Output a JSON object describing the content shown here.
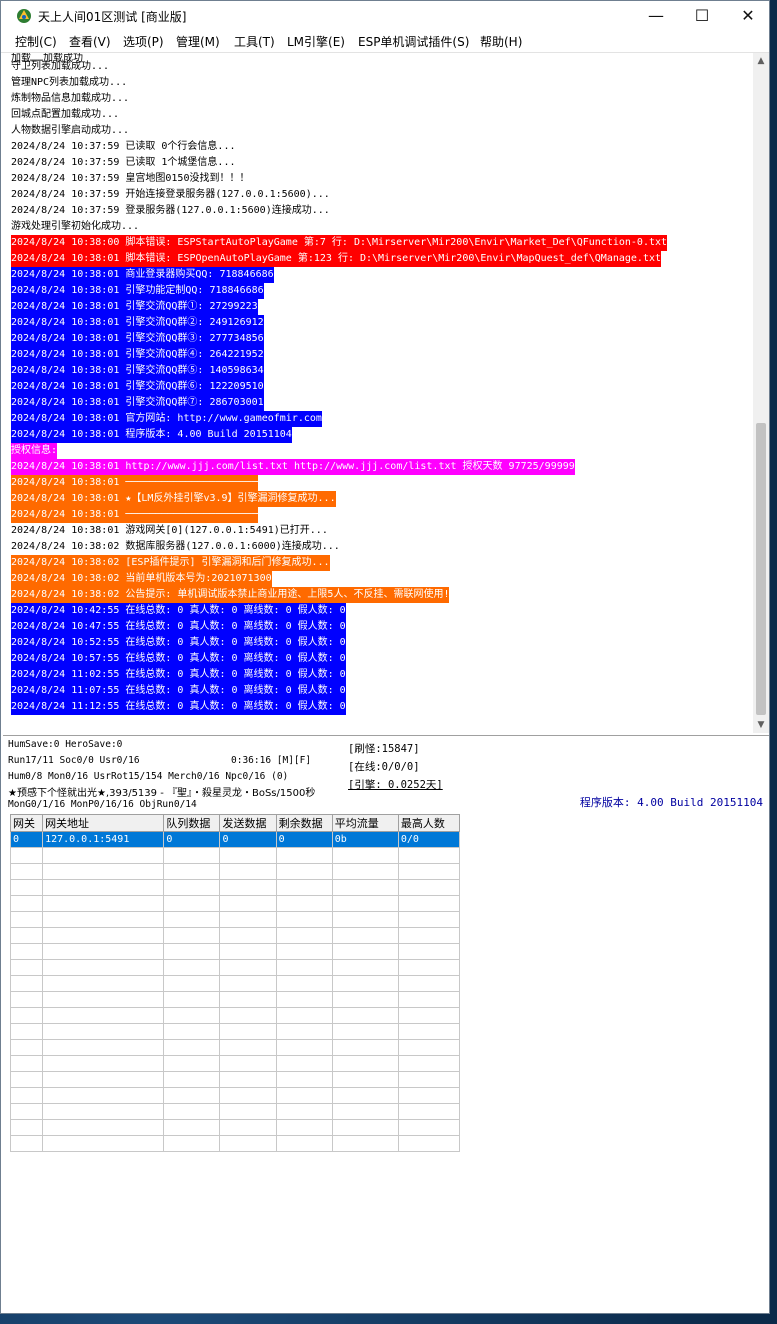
{
  "window": {
    "title": "天上人间01区测试 [商业版]",
    "controls": {
      "minimize": "—",
      "maximize": "☐",
      "close": "✕"
    }
  },
  "menu": [
    "控制(C)",
    "查看(V)",
    "选项(P)",
    "管理(M)",
    "工具(T)",
    "LM引擎(E)",
    "ESP单机调试插件(S)",
    "帮助(H)"
  ],
  "log": {
    "partial_top": "加载……加载成功",
    "lines": [
      {
        "text": "守卫列表加载成功...",
        "color": "none"
      },
      {
        "text": "管理NPC列表加载成功...",
        "color": "none"
      },
      {
        "text": "炼制物品信息加载成功...",
        "color": "none"
      },
      {
        "text": "回城点配置加载成功...",
        "color": "none"
      },
      {
        "text": "人物数据引擎启动成功...",
        "color": "none"
      },
      {
        "text": "2024/8/24 10:37:59 已读取 0个行会信息...",
        "color": "none"
      },
      {
        "text": "2024/8/24 10:37:59 已读取 1个城堡信息...",
        "color": "none"
      },
      {
        "text": "2024/8/24 10:37:59 皇宫地图0150没找到！！！",
        "color": "none"
      },
      {
        "text": "2024/8/24 10:37:59 开始连接登录服务器(127.0.0.1:5600)...",
        "color": "none"
      },
      {
        "text": "2024/8/24 10:37:59 登录服务器(127.0.0.1:5600)连接成功...",
        "color": "none"
      },
      {
        "text": "游戏处理引擎初始化成功...",
        "color": "none"
      },
      {
        "text": "2024/8/24 10:38:00 脚本错误: ESPStartAutoPlayGame 第:7 行: D:\\Mirserver\\Mir200\\Envir\\Market_Def\\QFunction-0.txt",
        "color": "red"
      },
      {
        "text": "2024/8/24 10:38:01 脚本错误: ESPOpenAutoPlayGame 第:123 行: D:\\Mirserver\\Mir200\\Envir\\MapQuest_def\\QManage.txt",
        "color": "red"
      },
      {
        "text": "2024/8/24 10:38:01 商业登录器购买QQ: 718846686",
        "color": "blue"
      },
      {
        "text": "2024/8/24 10:38:01 引擎功能定制QQ: 718846686",
        "color": "blue"
      },
      {
        "text": "2024/8/24 10:38:01 引擎交流QQ群①: 27299223",
        "color": "blue"
      },
      {
        "text": "2024/8/24 10:38:01 引擎交流QQ群②: 249126912",
        "color": "blue"
      },
      {
        "text": "2024/8/24 10:38:01 引擎交流QQ群③: 277734856",
        "color": "blue"
      },
      {
        "text": "2024/8/24 10:38:01 引擎交流QQ群④: 264221952",
        "color": "blue"
      },
      {
        "text": "2024/8/24 10:38:01 引擎交流QQ群⑤: 140598634",
        "color": "blue"
      },
      {
        "text": "2024/8/24 10:38:01 引擎交流QQ群⑥: 122209510",
        "color": "blue"
      },
      {
        "text": "2024/8/24 10:38:01 引擎交流QQ群⑦: 286703001",
        "color": "blue"
      },
      {
        "text": "2024/8/24 10:38:01 官方网站: http://www.gameofmir.com",
        "color": "blue"
      },
      {
        "text": "2024/8/24 10:38:01 程序版本: 4.00 Build 20151104",
        "color": "blue"
      },
      {
        "text": "授权信息:",
        "color": "magenta"
      },
      {
        "text": "2024/8/24 10:38:01 http://www.jjj.com/list.txt http://www.jjj.com/list.txt 授权天数 97725/99999",
        "color": "magenta"
      },
      {
        "text": "2024/8/24 10:38:01 ──────────────────────",
        "color": "orange"
      },
      {
        "text": "2024/8/24 10:38:01 ★【LM反外挂引擎v3.9】引擎漏洞修复成功...",
        "color": "orange"
      },
      {
        "text": "2024/8/24 10:38:01 ──────────────────────",
        "color": "orange"
      },
      {
        "text": "2024/8/24 10:38:01 游戏网关[0](127.0.0.1:5491)已打开...",
        "color": "none"
      },
      {
        "text": "2024/8/24 10:38:02 数据库服务器(127.0.0.1:6000)连接成功...",
        "color": "none"
      },
      {
        "text": "2024/8/24 10:38:02 [ESP插件提示] 引擎漏洞和后门修复成功...",
        "color": "orange"
      },
      {
        "text": "2024/8/24 10:38:02 当前单机版本号为:2021071300",
        "color": "orange"
      },
      {
        "text": "2024/8/24 10:38:02 公告提示: 单机调试版本禁止商业用途、上限5人、不反挂、需联网使用!",
        "color": "orange"
      },
      {
        "text": "2024/8/24 10:42:55 在线总数: 0 真人数: 0 离线数: 0 假人数: 0",
        "color": "blue"
      },
      {
        "text": "2024/8/24 10:47:55 在线总数: 0 真人数: 0 离线数: 0 假人数: 0",
        "color": "blue"
      },
      {
        "text": "2024/8/24 10:52:55 在线总数: 0 真人数: 0 离线数: 0 假人数: 0",
        "color": "blue"
      },
      {
        "text": "2024/8/24 10:57:55 在线总数: 0 真人数: 0 离线数: 0 假人数: 0",
        "color": "blue"
      },
      {
        "text": "2024/8/24 11:02:55 在线总数: 0 真人数: 0 离线数: 0 假人数: 0",
        "color": "blue"
      },
      {
        "text": "2024/8/24 11:07:55 在线总数: 0 真人数: 0 离线数: 0 假人数: 0",
        "color": "blue"
      },
      {
        "text": "2024/8/24 11:12:55 在线总数: 0 真人数: 0 离线数: 0 假人数: 0",
        "color": "blue"
      }
    ]
  },
  "status": {
    "line1": "HumSave:0 HeroSave:0",
    "line2": "Run17/11 Soc0/0 Usr0/16",
    "time": "0:36:16 [M][F]",
    "line3": "Hum0/8 Mon0/16 UsrRot15/154 Merch0/16 Npc0/16 (0)",
    "line4": "★预感下个怪就出光★,393/5139 - 『聖』・殺星灵龙・BoSs/1500秒",
    "line5": "MonG0/1/16 MonP0/16/16 ObjRun0/14",
    "refresh": "[刷怪:15847]",
    "online": "[在线:0/0/0]",
    "engine": "[引擎: 0.0252天]",
    "version": "程序版本: 4.00 Build 20151104"
  },
  "grid": {
    "headers": [
      "网关",
      "网关地址",
      "队列数据",
      "发送数据",
      "剩余数据",
      "平均流量",
      "最高人数"
    ],
    "rows": [
      [
        "0",
        "127.0.0.1:5491",
        "0",
        "0",
        "0",
        "0b",
        "0/0"
      ]
    ],
    "empty_rows": 19
  },
  "colors": {
    "red": "#ff0000",
    "blue": "#0000ff",
    "magenta": "#ff00ff",
    "orange": "#ff6a00",
    "selection": "#0078d7"
  }
}
